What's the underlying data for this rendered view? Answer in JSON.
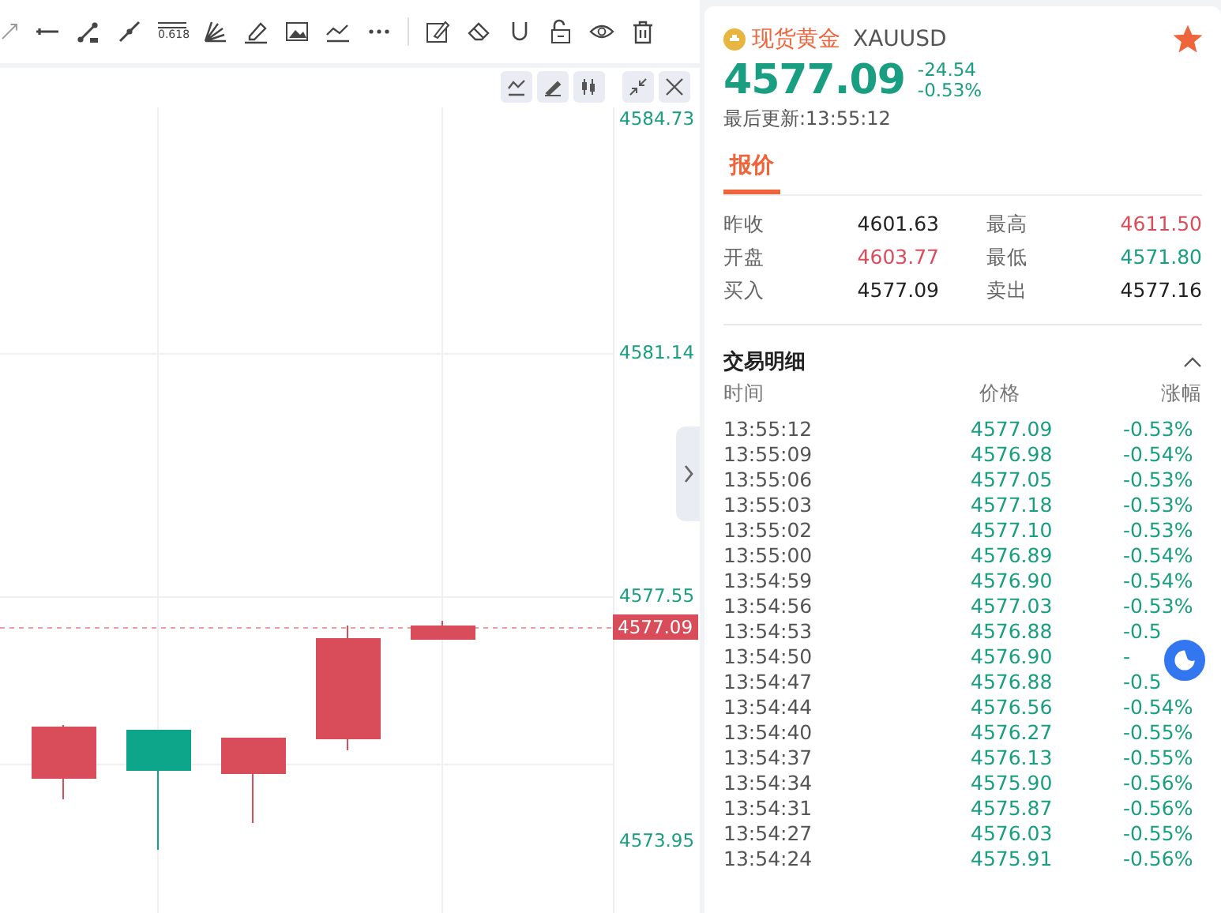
{
  "toolbar": {
    "fib_label": "0.618"
  },
  "chart": {
    "y_labels": [
      "4584.73",
      "4581.14",
      "4577.55",
      "4573.95"
    ],
    "last_price": "4577.09"
  },
  "quote": {
    "name": "现货黄金",
    "symbol": "XAUUSD",
    "favorite": true,
    "price": "4577.09",
    "change": "-24.54",
    "change_pct": "-0.53%",
    "updated": "最后更新:13:55:12"
  },
  "tabs": [
    {
      "label": "报价",
      "selected": true
    }
  ],
  "stats": [
    {
      "label": "昨收",
      "value": "4601.63",
      "color": "#222222"
    },
    {
      "label": "最高",
      "value": "4611.50",
      "color": "#d94d5a"
    },
    {
      "label": "开盘",
      "value": "4603.77",
      "color": "#d94d5a"
    },
    {
      "label": "最低",
      "value": "4571.80",
      "color": "#1a9e82"
    },
    {
      "label": "买入",
      "value": "4577.09",
      "color": "#222222"
    },
    {
      "label": "卖出",
      "value": "4577.16",
      "color": "#222222"
    }
  ],
  "trades": {
    "title": "交易明细",
    "expanded": true,
    "columns": [
      "时间",
      "价格",
      "涨幅"
    ],
    "rows": [
      {
        "time": "13:55:12",
        "price": "4577.09",
        "pct": "-0.53%"
      },
      {
        "time": "13:55:09",
        "price": "4576.98",
        "pct": "-0.54%"
      },
      {
        "time": "13:55:06",
        "price": "4577.05",
        "pct": "-0.53%"
      },
      {
        "time": "13:55:03",
        "price": "4577.18",
        "pct": "-0.53%"
      },
      {
        "time": "13:55:02",
        "price": "4577.10",
        "pct": "-0.53%"
      },
      {
        "time": "13:55:00",
        "price": "4576.89",
        "pct": "-0.54%"
      },
      {
        "time": "13:54:59",
        "price": "4576.90",
        "pct": "-0.54%"
      },
      {
        "time": "13:54:56",
        "price": "4577.03",
        "pct": "-0.53%"
      },
      {
        "time": "13:54:53",
        "price": "4576.88",
        "pct": "-0.5"
      },
      {
        "time": "13:54:50",
        "price": "4576.90",
        "pct": "-"
      },
      {
        "time": "13:54:47",
        "price": "4576.88",
        "pct": "-0.5"
      },
      {
        "time": "13:54:44",
        "price": "4576.56",
        "pct": "-0.54%"
      },
      {
        "time": "13:54:40",
        "price": "4576.27",
        "pct": "-0.55%"
      },
      {
        "time": "13:54:37",
        "price": "4576.13",
        "pct": "-0.55%"
      },
      {
        "time": "13:54:34",
        "price": "4575.90",
        "pct": "-0.56%"
      },
      {
        "time": "13:54:31",
        "price": "4575.87",
        "pct": "-0.56%"
      },
      {
        "time": "13:54:27",
        "price": "4576.03",
        "pct": "-0.55%"
      },
      {
        "time": "13:54:24",
        "price": "4575.91",
        "pct": "-0.56%"
      }
    ]
  }
}
